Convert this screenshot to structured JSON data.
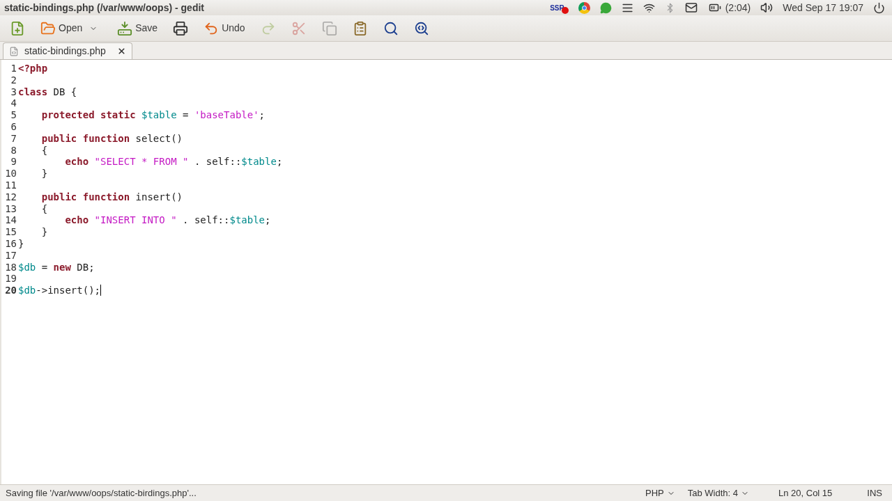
{
  "window": {
    "title": "static-bindings.php (/var/www/oops) - gedit"
  },
  "tray": {
    "battery": "(2:04)",
    "clock": "Wed Sep 17 19:07",
    "recorder_label": "SSR"
  },
  "toolbar": [
    {
      "kind": "new",
      "disabled": false
    },
    {
      "kind": "open",
      "label": "Open",
      "disabled": false
    },
    {
      "kind": "save",
      "label": "Save",
      "disabled": false
    },
    {
      "kind": "print",
      "disabled": false
    },
    {
      "kind": "undo",
      "label": "Undo",
      "disabled": false
    },
    {
      "kind": "redo",
      "disabled": true
    },
    {
      "kind": "cut",
      "disabled": true
    },
    {
      "kind": "copy",
      "disabled": true
    },
    {
      "kind": "paste",
      "disabled": false
    },
    {
      "kind": "find",
      "disabled": false
    },
    {
      "kind": "replace",
      "disabled": false
    }
  ],
  "tabs": [
    {
      "label": "static-bindings.php",
      "selected": true
    }
  ],
  "editor": {
    "lines": [
      {
        "number": "1",
        "current": false,
        "tokens": [
          {
            "text": "<?php",
            "kind": "keyword"
          }
        ]
      },
      {
        "number": "2",
        "current": false
      },
      {
        "number": "3",
        "current": false,
        "tokens": [
          {
            "text": "class",
            "kind": "keyword"
          },
          {
            "text": " DB {",
            "kind": "plain"
          }
        ]
      },
      {
        "number": "4",
        "current": false
      },
      {
        "number": "5",
        "current": false,
        "tokens": [
          {
            "text": "    protected static",
            "kind": "keyword"
          },
          {
            "text": " $table",
            "kind": "variable"
          },
          {
            "text": " = ",
            "kind": "plain"
          },
          {
            "text": "'baseTable'",
            "kind": "string"
          },
          {
            "text": ";",
            "kind": "plain"
          }
        ]
      },
      {
        "number": "6",
        "current": false
      },
      {
        "number": "7",
        "current": false,
        "tokens": [
          {
            "text": "    public function",
            "kind": "keyword"
          },
          {
            "text": " select()",
            "kind": "plain"
          }
        ]
      },
      {
        "number": "8",
        "current": false,
        "tokens": [
          {
            "text": "    {",
            "kind": "plain"
          }
        ]
      },
      {
        "number": "9",
        "current": false,
        "tokens": [
          {
            "text": "        echo",
            "kind": "keyword"
          },
          {
            "text": " \"SELECT * FROM \"",
            "kind": "string"
          },
          {
            "text": " . self::",
            "kind": "plain"
          },
          {
            "text": "$table",
            "kind": "variable"
          },
          {
            "text": ";",
            "kind": "plain"
          }
        ]
      },
      {
        "number": "10",
        "current": false,
        "tokens": [
          {
            "text": "    }",
            "kind": "plain"
          }
        ]
      },
      {
        "number": "11",
        "current": false
      },
      {
        "number": "12",
        "current": false,
        "tokens": [
          {
            "text": "    public function",
            "kind": "keyword"
          },
          {
            "text": " insert()",
            "kind": "plain"
          }
        ]
      },
      {
        "number": "13",
        "current": false,
        "tokens": [
          {
            "text": "    {",
            "kind": "plain"
          }
        ]
      },
      {
        "number": "14",
        "current": false,
        "tokens": [
          {
            "text": "        echo",
            "kind": "keyword"
          },
          {
            "text": " \"INSERT INTO \"",
            "kind": "string"
          },
          {
            "text": " . self::",
            "kind": "plain"
          },
          {
            "text": "$table",
            "kind": "variable"
          },
          {
            "text": ";",
            "kind": "plain"
          }
        ]
      },
      {
        "number": "15",
        "current": false,
        "tokens": [
          {
            "text": "    }",
            "kind": "plain"
          }
        ]
      },
      {
        "number": "16",
        "current": false,
        "tokens": [
          {
            "text": "}",
            "kind": "plain"
          }
        ]
      },
      {
        "number": "17",
        "current": false
      },
      {
        "number": "18",
        "current": false,
        "tokens": [
          {
            "text": "$db",
            "kind": "variable"
          },
          {
            "text": " = ",
            "kind": "plain"
          },
          {
            "text": "new",
            "kind": "keyword"
          },
          {
            "text": " DB;",
            "kind": "plain"
          }
        ]
      },
      {
        "number": "19",
        "current": false
      },
      {
        "number": "20",
        "current": true,
        "tokens": [
          {
            "text": "$db",
            "kind": "variable"
          },
          {
            "text": "->insert();",
            "kind": "plain"
          }
        ]
      }
    ]
  },
  "status_bar": {
    "message": "Saving file '/var/www/oops/static-birdings.php'...",
    "language": "PHP",
    "tab_width": "Tab Width: 4",
    "position": "Ln 20, Col 15",
    "mode": "INS"
  }
}
